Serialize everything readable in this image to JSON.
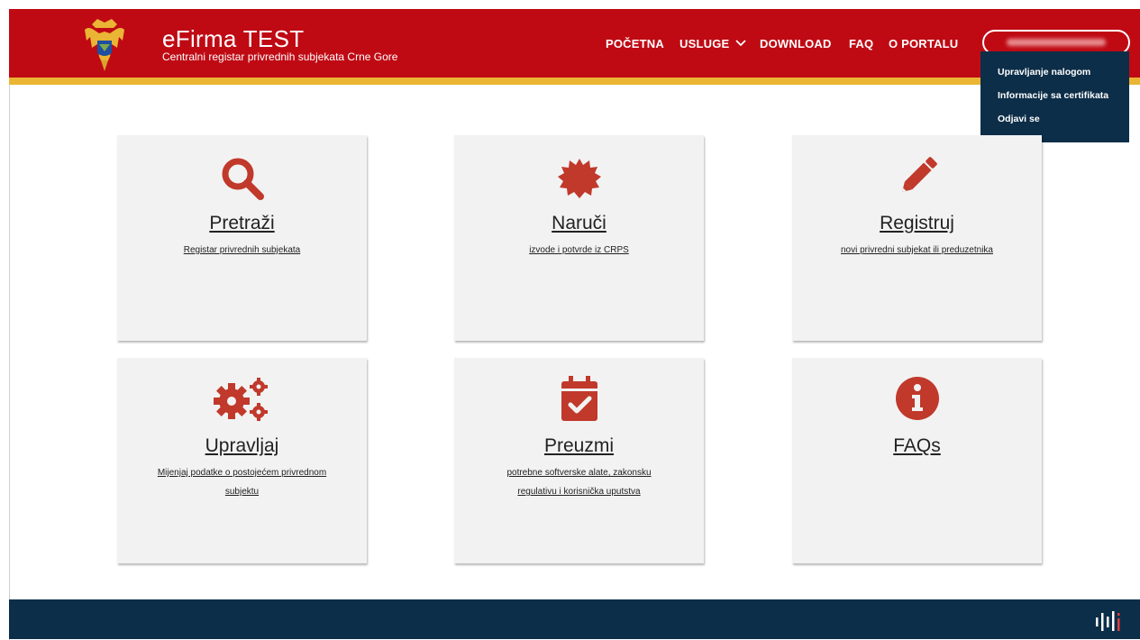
{
  "header": {
    "title": "eFirma TEST",
    "subtitle": "Centralni registar privrednih subjekata Crne Gore",
    "nav": [
      "POČETNA",
      "USLUGE",
      "DOWNLOAD",
      "FAQ",
      "O PORTALU"
    ],
    "brand_color": "#bf0a14",
    "accent_color": "#eab534"
  },
  "user_menu": {
    "items": [
      "Upravljanje nalogom",
      "Informacije sa certifikata",
      "Odjavi se"
    ],
    "bg_color": "#0d2e48"
  },
  "cards": [
    {
      "icon": "search-icon",
      "title": "Pretraži",
      "desc": [
        "Registar privrednih subjekata"
      ]
    },
    {
      "icon": "certificate-icon",
      "title": "Naruči",
      "desc": [
        "izvode i potvrde iz CRPS"
      ]
    },
    {
      "icon": "pencil-icon",
      "title": "Registruj",
      "desc": [
        "novi privredni subjekat ili preduzetnika"
      ]
    },
    {
      "icon": "gears-icon",
      "title": "Upravljaj",
      "desc": [
        "Mijenjaj podatke o postojećem privrednom",
        "subjektu"
      ]
    },
    {
      "icon": "calendar-check-icon",
      "title": "Preuzmi",
      "desc": [
        "potrebne softverske alate, zakonsku",
        "regulativu i korisnička uputstva"
      ]
    },
    {
      "icon": "info-icon",
      "title": "FAQs",
      "desc": []
    }
  ],
  "icon_color": "#c0392b",
  "footer": {
    "bg_color": "#0d2e48"
  }
}
